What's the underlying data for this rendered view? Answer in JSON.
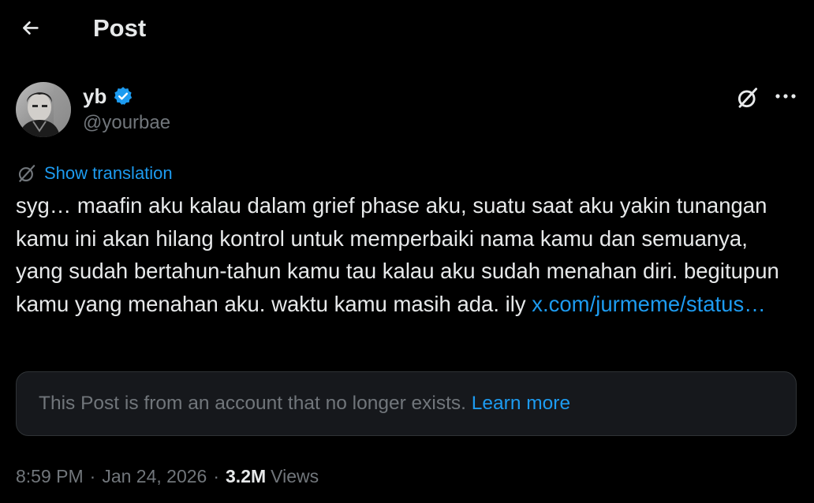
{
  "colors": {
    "background": "#000000",
    "text_primary": "#e7e9ea",
    "text_secondary": "#71767b",
    "accent": "#1d9bf0",
    "notice_background": "#16181c",
    "notice_border": "#2f3336"
  },
  "header": {
    "title": "Post",
    "back_icon": "arrow-left-icon"
  },
  "author": {
    "display_name": "yb",
    "handle": "@yourbae",
    "verified": true,
    "verified_icon": "verified-badge-icon",
    "avatar": "avatar-photo"
  },
  "actions": {
    "grok_icon": "grok-icon",
    "more_icon": "more-dots-icon"
  },
  "translate": {
    "icon": "grok-icon",
    "label": "Show translation"
  },
  "post": {
    "text": "syg… maafin aku kalau dalam grief phase aku, suatu saat aku yakin tunangan kamu ini akan hilang kontrol untuk memperbaiki nama kamu dan semuanya, yang sudah bertahun-tahun kamu tau kalau aku sudah menahan diri. begitupun kamu yang menahan aku. waktu kamu masih ada. ily ",
    "link_text": "x.com/jurmeme/status…"
  },
  "notice": {
    "text": "This Post is from an account that no longer exists. ",
    "link_text": "Learn more"
  },
  "meta": {
    "time": "8:59 PM",
    "separator": "·",
    "date": "Jan 24, 2026",
    "views_count": "3.2M",
    "views_label": "Views"
  }
}
